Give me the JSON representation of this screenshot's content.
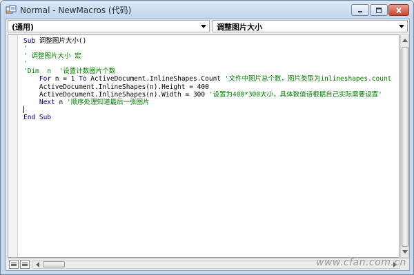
{
  "window": {
    "title": "Normal - NewMacros (代码)"
  },
  "toolbar": {
    "object_combo": "(通用)",
    "procedure_combo": "调整图片大小"
  },
  "code": {
    "lines": [
      [
        {
          "t": "Sub ",
          "c": "kw"
        },
        {
          "t": "调整图片大小()",
          "c": "tx"
        }
      ],
      [
        {
          "t": "'",
          "c": "cm"
        }
      ],
      [
        {
          "t": "' 调整图片大小 宏",
          "c": "cm"
        }
      ],
      [
        {
          "t": "'",
          "c": "cm"
        }
      ],
      [
        {
          "t": "'Dim  n  '设置计数图片个数",
          "c": "cm"
        }
      ],
      [
        {
          "t": "    For ",
          "c": "kw"
        },
        {
          "t": "n = 1 ",
          "c": "tx"
        },
        {
          "t": "To ",
          "c": "kw"
        },
        {
          "t": "ActiveDocument.InlineShapes.Count ",
          "c": "tx"
        },
        {
          "t": "'文件中图片总个数，图片类型为inlineshapes.count",
          "c": "cm"
        }
      ],
      [
        {
          "t": "    ActiveDocument.InlineShapes(n).Height = 400",
          "c": "tx"
        }
      ],
      [
        {
          "t": "    ActiveDocument.InlineShapes(n).Width = 300 ",
          "c": "tx"
        },
        {
          "t": "'设置为400*300大小，具体数值请根据自己实际需要设置'",
          "c": "cm"
        }
      ],
      [
        {
          "t": "    Next ",
          "c": "kw"
        },
        {
          "t": "n ",
          "c": "tx"
        },
        {
          "t": "'顺序处理知道最后一张图片",
          "c": "cm"
        }
      ],
      [
        {
          "t": "",
          "c": "tx",
          "caret": true
        }
      ],
      [
        {
          "t": "End Sub",
          "c": "kw"
        }
      ]
    ]
  },
  "watermark": "www.cfan.com.cn",
  "icons": {
    "app": "vba-module-icon",
    "minimize": "minimize-icon",
    "maximize": "maximize-icon",
    "close": "close-icon"
  },
  "colors": {
    "keyword": "#00007a",
    "comment": "#008000",
    "text": "#000000",
    "close_button": "#c9452d"
  }
}
